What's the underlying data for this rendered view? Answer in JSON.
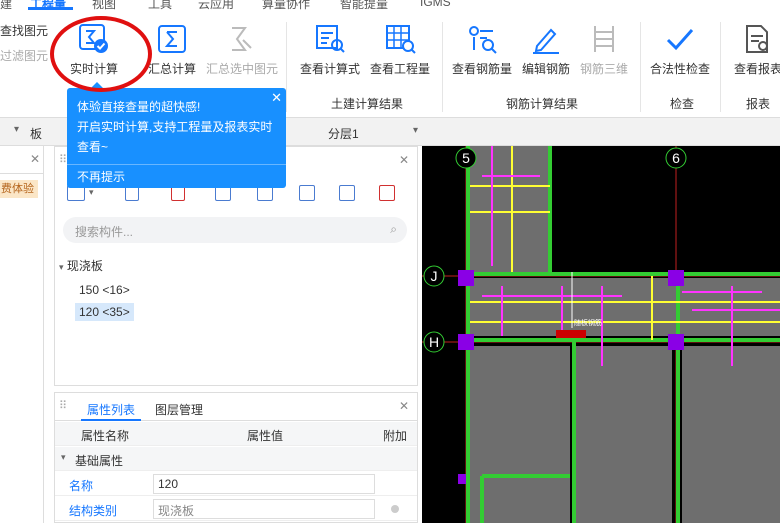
{
  "top_tabs": [
    "建",
    "视图",
    "工具",
    "云应用",
    "算量协作",
    "智能提量",
    "IGMS"
  ],
  "active_tab": "工程量",
  "ribbon": {
    "left_links": [
      "查找图元",
      "过滤图元"
    ],
    "buttons": [
      {
        "label": "实时计算",
        "icon": "realtime-calc-icon"
      },
      {
        "label": "汇总计算",
        "icon": "sigma-icon"
      },
      {
        "label": "汇总选中图元",
        "icon": "sigma-selected-icon"
      },
      {
        "label": "查看计算式",
        "icon": "view-formula-icon"
      },
      {
        "label": "查看工程量",
        "icon": "view-quantity-icon"
      },
      {
        "label": "查看钢筋量",
        "icon": "view-rebar-icon"
      },
      {
        "label": "编辑钢筋",
        "icon": "edit-rebar-icon"
      },
      {
        "label": "钢筋三维",
        "icon": "rebar-3d-icon"
      },
      {
        "label": "合法性检查",
        "icon": "check-icon"
      },
      {
        "label": "查看报表",
        "icon": "report-icon"
      }
    ],
    "groups": [
      "土建计算结果",
      "钢筋计算结果",
      "检查",
      "报表"
    ]
  },
  "tooltip": {
    "line1": "体验直接查量的超快感!",
    "line2": "开启实时计算,支持工程量及报表实时查看~",
    "dismiss": "不再提示",
    "close": "✕"
  },
  "toolbar2": {
    "combo1": "板",
    "combo2": "分层1"
  },
  "left_panel": {
    "badge": "费体验"
  },
  "component_panel": {
    "search_placeholder": "搜索构件...",
    "tree_root": "现浇板",
    "items": [
      "150 <16>",
      "120 <35>"
    ],
    "selected_index": 1
  },
  "property_panel": {
    "tabs": [
      "属性列表",
      "图层管理"
    ],
    "columns": [
      "属性名称",
      "属性值",
      "附加"
    ],
    "section": "基础属性",
    "rows": [
      {
        "name": "名称",
        "value": "120"
      },
      {
        "name": "结构类别",
        "value": "现浇板"
      }
    ]
  },
  "canvas": {
    "axis_labels": [
      "5",
      "6",
      "J",
      "H"
    ],
    "annotation": "随板钢筋"
  },
  "colors": {
    "accent": "#1890ff",
    "highlight_circle": "#e01010",
    "beam_green": "#33cc33",
    "rebar_yellow": "#ffff33",
    "rebar_magenta": "#ff33ff"
  }
}
